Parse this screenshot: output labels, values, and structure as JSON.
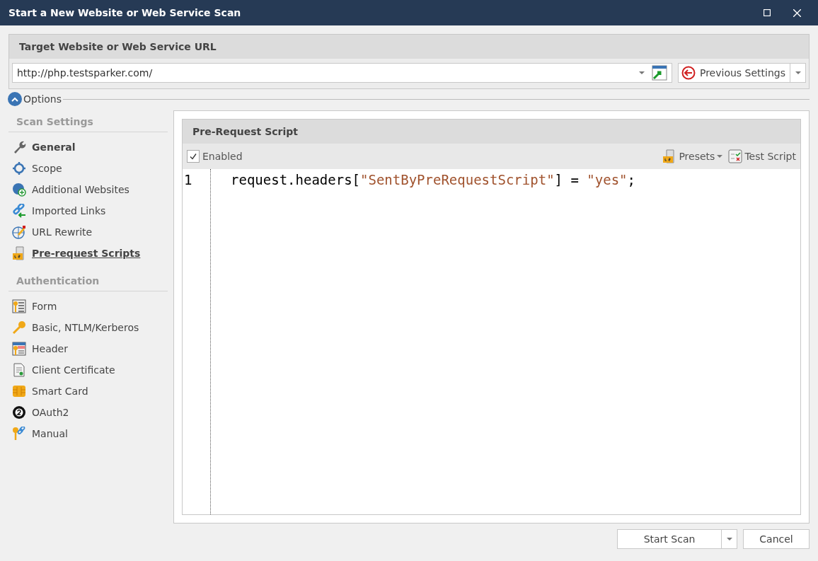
{
  "window": {
    "title": "Start a New Website or Web Service Scan"
  },
  "target": {
    "heading": "Target Website or Web Service URL",
    "url": "http://php.testsparker.com/",
    "previous_settings": "Previous Settings"
  },
  "options": {
    "label": "Options",
    "expanded": true
  },
  "sidebar": [
    {
      "heading": "Scan Settings",
      "items": [
        {
          "label": "General",
          "selected": false,
          "bold": true
        },
        {
          "label": "Scope",
          "selected": false,
          "bold": false
        },
        {
          "label": "Additional Websites",
          "selected": false,
          "bold": false
        },
        {
          "label": "Imported Links",
          "selected": false,
          "bold": false
        },
        {
          "label": "URL Rewrite",
          "selected": false,
          "bold": false
        },
        {
          "label": "Pre-request Scripts",
          "selected": true,
          "bold": true
        }
      ]
    },
    {
      "heading": "Authentication",
      "items": [
        {
          "label": "Form",
          "selected": false,
          "bold": false
        },
        {
          "label": "Basic, NTLM/Kerberos",
          "selected": false,
          "bold": false
        },
        {
          "label": "Header",
          "selected": false,
          "bold": false
        },
        {
          "label": "Client Certificate",
          "selected": false,
          "bold": false
        },
        {
          "label": "Smart Card",
          "selected": false,
          "bold": false
        },
        {
          "label": "OAuth2",
          "selected": false,
          "bold": false
        },
        {
          "label": "Manual",
          "selected": false,
          "bold": false
        }
      ]
    }
  ],
  "script_panel": {
    "title": "Pre-Request Script",
    "enabled": {
      "label": "Enabled",
      "checked": true
    },
    "presets": "Presets",
    "test_script": "Test Script",
    "lines": [
      {
        "number": "1",
        "tokens": [
          {
            "kind": "plain",
            "text": "request.headers["
          },
          {
            "kind": "string",
            "text": "\"SentByPreRequestScript\""
          },
          {
            "kind": "plain",
            "text": "] = "
          },
          {
            "kind": "string",
            "text": "\"yes\""
          },
          {
            "kind": "plain",
            "text": ";"
          }
        ]
      }
    ]
  },
  "buttons": {
    "start_scan": "Start Scan",
    "cancel": "Cancel"
  }
}
